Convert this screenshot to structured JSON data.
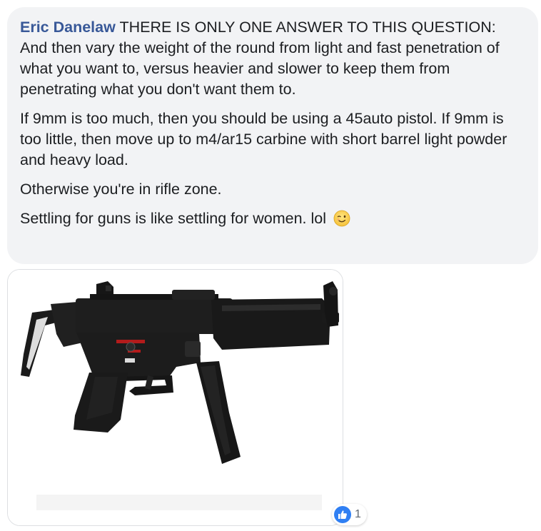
{
  "comment": {
    "author": "Eric Danelaw",
    "heading": "THERE IS ONLY ONE ANSWER TO THIS QUESTION:",
    "line_1": "And then vary the weight of the round from light and fast penetration of what you want to, versus heavier and slower to keep them from penetrating what you don't want them to.",
    "paragraph_2": "If 9mm is too much, then you should be using a 45auto pistol. If 9mm is too little, then move up to m4/ar15 carbine with short barrel light powder and heavy load.",
    "paragraph_3": "Otherwise you're in rifle zone.",
    "paragraph_4": "Settling for guns is like settling for women. lol",
    "emoji_icon": "winking-face-emoji"
  },
  "attachment": {
    "image_subject": "submachine-gun-photo"
  },
  "reactions": {
    "icon": "thumbs-up-like-icon",
    "icon_color": "#2f7ff3",
    "count": "1"
  },
  "colors": {
    "author_link": "#385898",
    "bubble_background": "#f2f3f5",
    "text": "#1c1e21"
  }
}
